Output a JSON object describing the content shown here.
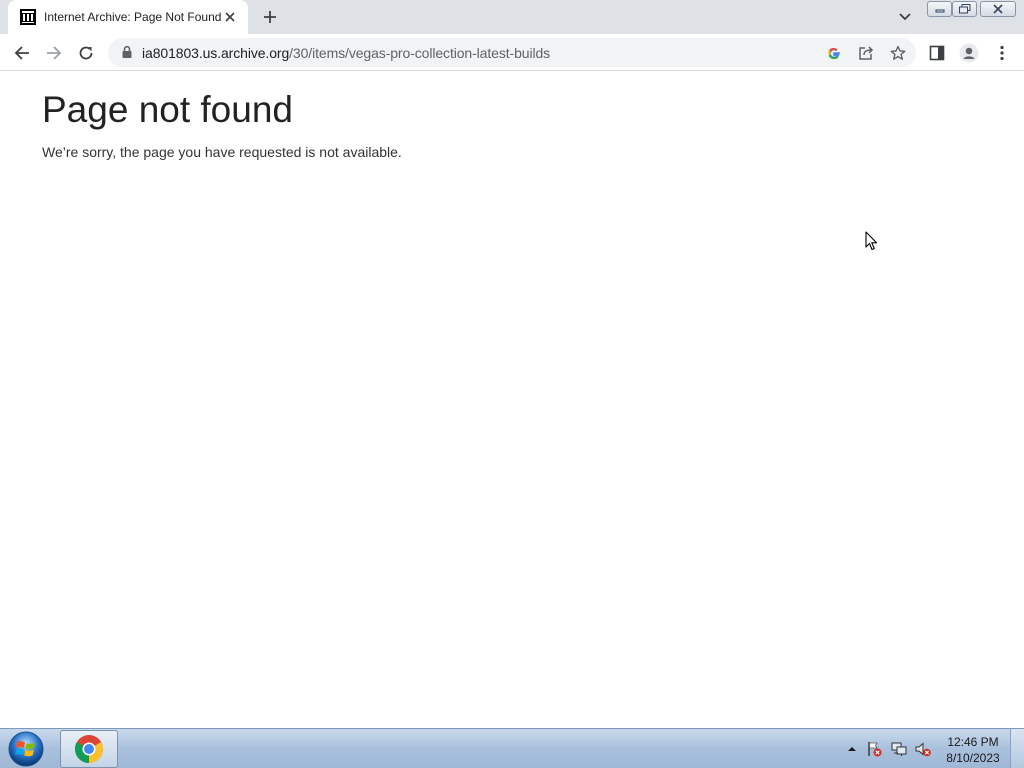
{
  "browser": {
    "tab": {
      "title": "Internet Archive: Page Not Found",
      "favicon": "archive-building-icon"
    },
    "new_tab_icon": "plus-icon",
    "tab_search_icon": "chevron-down-icon",
    "window_controls": [
      "minimize-icon",
      "restore-icon",
      "close-icon"
    ],
    "toolbar": {
      "back_icon": "arrow-left-icon",
      "forward_icon": "arrow-right-icon",
      "reload_icon": "reload-icon",
      "url_host": "ia801803.us.archive.org",
      "url_path": "/30/items/vegas-pro-collection-latest-builds",
      "omnibox_icons": [
        "google-icon",
        "share-icon",
        "star-icon"
      ],
      "side_panel_icon": "side-panel-icon",
      "profile_icon": "profile-icon",
      "menu_icon": "kebab-menu-icon"
    }
  },
  "page": {
    "title": "Page not found",
    "message": "We’re sorry, the page you have requested is not available."
  },
  "taskbar": {
    "start_icon": "windows-start-icon",
    "pinned": [
      "chrome-icon"
    ],
    "tray_icons": [
      "tray-arrow-icon",
      "action-center-flag-icon",
      "network-icon",
      "volume-muted-icon"
    ],
    "time": "12:46 PM",
    "date": "8/10/2023"
  },
  "colors": {
    "tabstrip_bg": "#dee1e6",
    "omnibox_bg": "#f1f3f4",
    "taskbar_bg": "#a9c1dd",
    "text_primary": "#222222"
  }
}
